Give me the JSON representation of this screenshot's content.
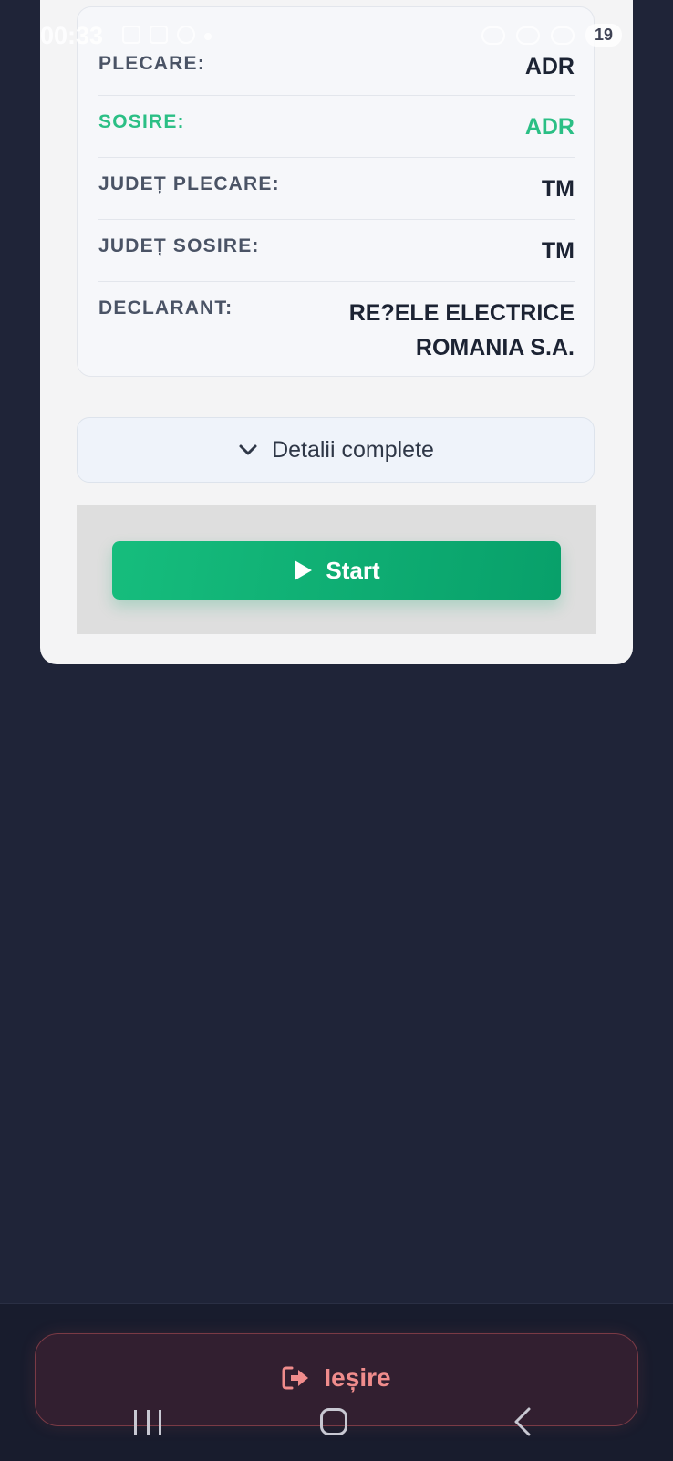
{
  "status_bar": {
    "time": "00:33",
    "battery": "19"
  },
  "info": {
    "rows": [
      {
        "label": "PLECARE:",
        "value": "ADR"
      },
      {
        "label": "SOSIRE:",
        "value": "ADR"
      },
      {
        "label": "JUDEȚ PLECARE:",
        "value": "TM"
      },
      {
        "label": "JUDEȚ SOSIRE:",
        "value": "TM"
      },
      {
        "label": "DECLARANT:",
        "value_line1": "RE?ELE ELECTRICE",
        "value_line2": "ROMANIA S.A."
      }
    ]
  },
  "details_button": {
    "label": "Detalii complete",
    "icon": "chevron-down-icon"
  },
  "start_button": {
    "label": "Start",
    "icon": "play-icon"
  },
  "exit_button": {
    "label": "Ieșire",
    "icon": "sign-out-icon"
  },
  "colors": {
    "background": "#1f2438",
    "accent_green": "#16bd7d",
    "exit_red": "#f08c8c"
  }
}
